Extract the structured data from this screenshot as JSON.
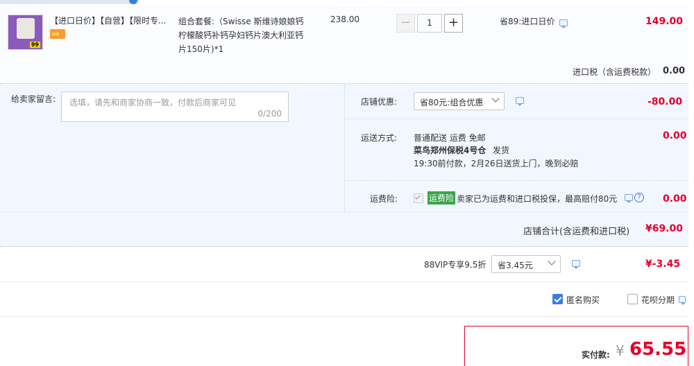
{
  "product": {
    "tags": "【进口日价】【自营】【限时专...",
    "title": "组合套餐:（Swisse 斯维诗娘娘钙柠檬酸钙补钙孕妇钙片澳大利亚钙片150片)*1",
    "unit_price": "238.00",
    "quantity": "1",
    "discount_label": "省89:进口日价",
    "subtotal": "149.00",
    "thumb_badge": "99"
  },
  "import_tax": {
    "label": "进口税（含运费税款）",
    "value": "0.00"
  },
  "message": {
    "label": "给卖家留言:",
    "placeholder": "选填，请先和商家协商一致，付款后商家可见",
    "counter": "0/200"
  },
  "store_discount": {
    "label": "店铺优惠:",
    "selected": "省80元:组合优惠",
    "value": "-80.00"
  },
  "shipping": {
    "label": "运送方式:",
    "line1": "普通配送 运费 免邮",
    "warehouse": "菜鸟郑州保税4号仓",
    "ship_note": "发货",
    "line3": "19:30前付款，2月26日送货上门，晚到必赔",
    "value": "0.00"
  },
  "insurance": {
    "label": "运费险:",
    "badge": "运费险",
    "text": "卖家已为运费和进口税投保，最高赔付80元",
    "value": "0.00"
  },
  "store_total": {
    "label": "店铺合计(含运费和进口税)",
    "value": "¥69.00"
  },
  "vip": {
    "label": "88VIP专享9.5折",
    "selected": "省3.45元",
    "value": "¥-3.45"
  },
  "options": {
    "anonymous": "匿名购买",
    "huabei": "花呗分期"
  },
  "payment": {
    "label": "实付款:",
    "currency": "¥",
    "amount": "65.55"
  },
  "colors": {
    "accent_red": "#e4002b",
    "panel_blue": "#f2f7ff",
    "badge_green": "#3aa44b"
  }
}
